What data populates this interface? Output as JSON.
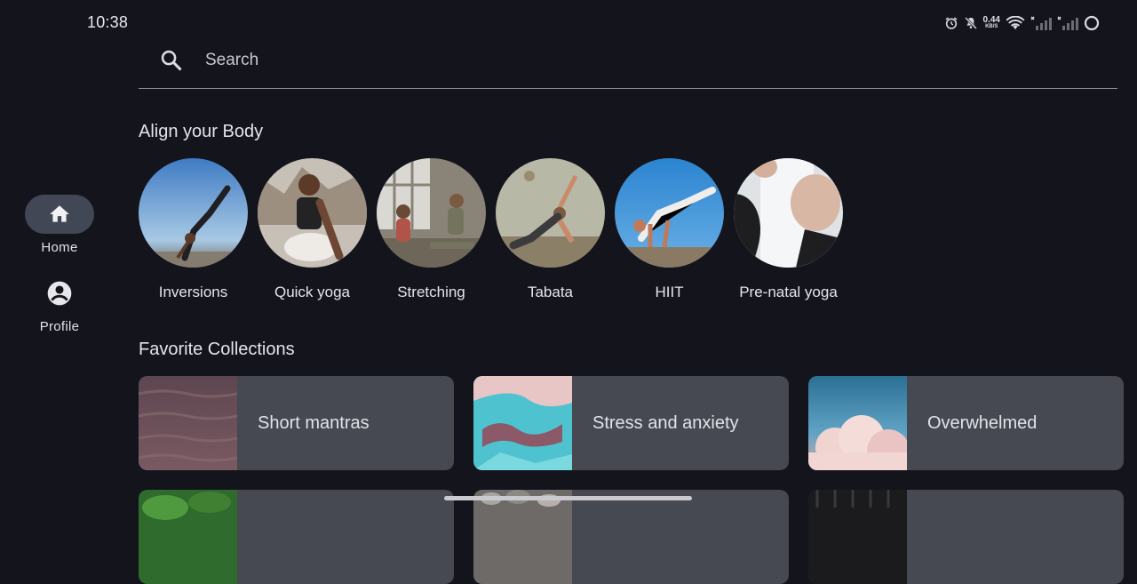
{
  "status_bar": {
    "time": "10:38",
    "net_speed": "0.44",
    "net_unit": "KB/S"
  },
  "nav": {
    "home_label": "Home",
    "profile_label": "Profile"
  },
  "search": {
    "placeholder": "Search"
  },
  "sections": {
    "align_title": "Align your Body",
    "favorites_title": "Favorite Collections"
  },
  "categories": [
    {
      "label": "Inversions"
    },
    {
      "label": "Quick yoga"
    },
    {
      "label": "Stretching"
    },
    {
      "label": "Tabata"
    },
    {
      "label": "HIIT"
    },
    {
      "label": "Pre-natal yoga"
    }
  ],
  "collections": [
    {
      "label": "Short mantras"
    },
    {
      "label": "Stress and anxiety"
    },
    {
      "label": "Overwhelmed"
    }
  ],
  "colors": {
    "background": "#14151c",
    "nav_active": "#424756",
    "card": "#464952"
  }
}
